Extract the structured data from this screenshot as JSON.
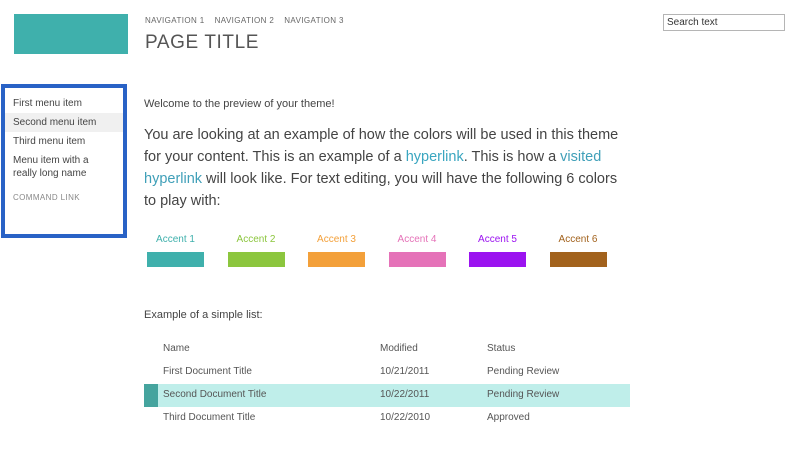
{
  "header": {
    "nav": [
      "NAVIGATION 1",
      "NAVIGATION 2",
      "NAVIGATION 3"
    ],
    "title": "PAGE TITLE"
  },
  "search": {
    "placeholder": "Search text"
  },
  "sidebar": {
    "items": [
      {
        "label": "First menu item"
      },
      {
        "label": "Second menu item",
        "selected": true
      },
      {
        "label": "Third menu item"
      },
      {
        "label": "Menu item with a really long name"
      }
    ],
    "command_link": "COMMAND LINK"
  },
  "content": {
    "welcome": "Welcome to the preview of your theme!",
    "intro_1": "You are looking at an example of how the colors will be used in this theme for your content. This is an example of a ",
    "hyperlink": "hyperlink",
    "intro_2": ". This is how a ",
    "visited_hyperlink": "visited hyperlink",
    "intro_3": " will look like. For text editing, you will have the following 6 colors to play with:"
  },
  "accents": [
    {
      "label": "Accent 1",
      "color": "#3fb0ac"
    },
    {
      "label": "Accent 2",
      "color": "#8cc63e"
    },
    {
      "label": "Accent 3",
      "color": "#f3a03a"
    },
    {
      "label": "Accent 4",
      "color": "#e572b8"
    },
    {
      "label": "Accent 5",
      "color": "#9b13f0"
    },
    {
      "label": "Accent 6",
      "color": "#a2621d"
    }
  ],
  "list": {
    "caption": "Example of a simple list:",
    "columns": [
      "Name",
      "Modified",
      "Status"
    ],
    "rows": [
      {
        "name": "First Document Title",
        "modified": "10/21/2011",
        "status": "Pending Review"
      },
      {
        "name": "Second Document Title",
        "modified": "10/22/2011",
        "status": "Pending Review",
        "selected": true
      },
      {
        "name": "Third Document Title",
        "modified": "10/22/2010",
        "status": "Approved"
      }
    ]
  }
}
